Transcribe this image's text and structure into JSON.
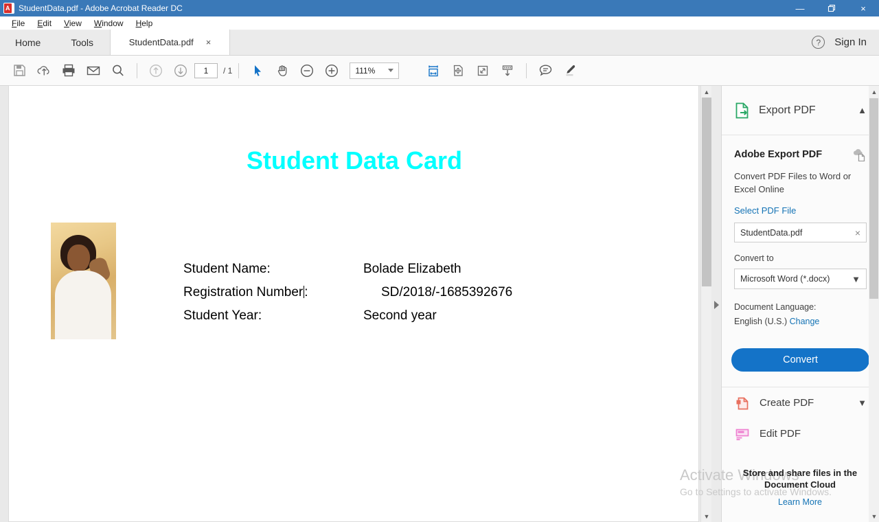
{
  "window": {
    "title": "StudentData.pdf - Adobe Acrobat Reader DC",
    "app_icon": "pdf-document-icon",
    "minimize": "—",
    "restore": "❐",
    "close": "×"
  },
  "menubar": {
    "items": [
      {
        "pre": "",
        "key": "F",
        "post": "ile"
      },
      {
        "pre": "",
        "key": "E",
        "post": "dit"
      },
      {
        "pre": "",
        "key": "V",
        "post": "iew"
      },
      {
        "pre": "",
        "key": "W",
        "post": "indow"
      },
      {
        "pre": "",
        "key": "H",
        "post": "elp"
      }
    ]
  },
  "tabbar": {
    "home": "Home",
    "tools": "Tools",
    "document_tab": "StudentData.pdf",
    "close_glyph": "×",
    "help_glyph": "?",
    "signin": "Sign In"
  },
  "toolbar": {
    "save": "save-icon",
    "upload_cloud": "upload-to-cloud-icon",
    "print": "print-icon",
    "email": "email-icon",
    "search": "search-icon",
    "prev_page": "previous-page-icon",
    "next_page": "next-page-icon",
    "page_current": "1",
    "page_total": "/ 1",
    "select_tool": "select-cursor-icon",
    "hand_tool": "hand-tool-icon",
    "zoom_out": "zoom-out-icon",
    "zoom_in": "zoom-in-icon",
    "zoom_value": "111%",
    "fit_width": "fit-width-icon",
    "fit_page": "fit-page-icon",
    "full_screen": "full-screen-icon",
    "scroll_mode": "scroll-mode-icon",
    "comment": "comment-icon",
    "highlight": "highlight-pen-icon"
  },
  "document": {
    "title": "Student Data Card",
    "title_color": "#00ffff",
    "photo_alt": "student-photo",
    "rows": [
      {
        "label": "Student Name:",
        "value": "Bolade Elizabeth",
        "indent": false,
        "caret": false
      },
      {
        "label": "Registration Number",
        "value": "SD/2018/-1685392676",
        "indent": true,
        "caret": true
      },
      {
        "label": "Student Year:",
        "value": "Second year",
        "indent": false,
        "caret": false
      }
    ],
    "caret_suffix": ":"
  },
  "right_panel": {
    "header": {
      "title": "Export PDF",
      "icon": "export-pdf-icon",
      "collapse": "⌃"
    },
    "heading": "Adobe Export PDF",
    "heading_icon": "document-cloud-icon",
    "description": "Convert PDF Files to Word or Excel Online",
    "select_file_link": "Select PDF File",
    "file_name": "StudentData.pdf",
    "file_clear": "×",
    "convert_to_label": "Convert to",
    "convert_to_value": "Microsoft Word (*.docx)",
    "convert_to_caret": "⌄",
    "language_label": "Document Language:",
    "language_value": "English (U.S.)",
    "language_change": "Change",
    "convert_button": "Convert",
    "tools": [
      {
        "label": "Create PDF",
        "icon": "create-pdf-icon",
        "chevron": "⌄"
      },
      {
        "label": "Edit PDF",
        "icon": "edit-pdf-icon",
        "chevron": ""
      }
    ]
  },
  "promo": {
    "line1": "Store and share files in the",
    "line2": "Document Cloud",
    "learn_more": "Learn More"
  },
  "watermark": {
    "line1": "Activate Windows",
    "line2": "Go to Settings to activate Windows."
  }
}
